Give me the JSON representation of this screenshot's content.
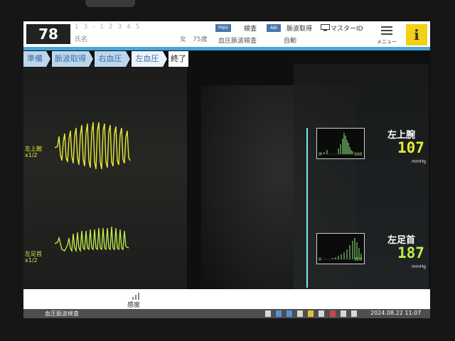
{
  "header": {
    "patient_number": "78",
    "patient_id_masked": "1 3 - 1 2 3 4 5",
    "name_label": "氏名",
    "sex_age": "女　75歳",
    "pwv_badge": "PWV",
    "exam_label": "検査",
    "exam_type": "血圧脈波検査",
    "abi_badge": "ABI",
    "pulse_acq_label": "脈波取得",
    "auto_label": "自動",
    "master_id_label": "マスターID",
    "menu_label": "メニュー",
    "info_label": "i"
  },
  "steps": [
    {
      "label": "準備",
      "state": "done"
    },
    {
      "label": "脈波取得",
      "state": "done"
    },
    {
      "label": "右血圧",
      "state": "done"
    },
    {
      "label": "左血圧",
      "state": "current"
    },
    {
      "label": "終了",
      "state": "todo"
    }
  ],
  "waveforms": {
    "left_arm": {
      "label": "左上腕",
      "scale": "x1/2",
      "color": "#e6ea35"
    },
    "left_ankle": {
      "label": "左足首",
      "scale": "x1/2",
      "color": "#c6f04a"
    }
  },
  "readings": [
    {
      "site": "左上腕",
      "value": "107",
      "unit": "mmHg",
      "axis_start": "0",
      "axis_end": "300",
      "color": "#e6ea35"
    },
    {
      "site": "左足首",
      "value": "187",
      "unit": "mmHg",
      "axis_start": "0",
      "axis_end": "300",
      "color": "#b9f04a"
    }
  ],
  "bottom": {
    "sensitivity_label": "感度"
  },
  "status": {
    "mode_label": "血圧脈波検査",
    "datetime": "2024.08.22  11:07"
  },
  "colors": {
    "accent_blue": "#49a6db",
    "info_yellow": "#f2d114",
    "cursor_cyan": "#7ee8ef"
  }
}
